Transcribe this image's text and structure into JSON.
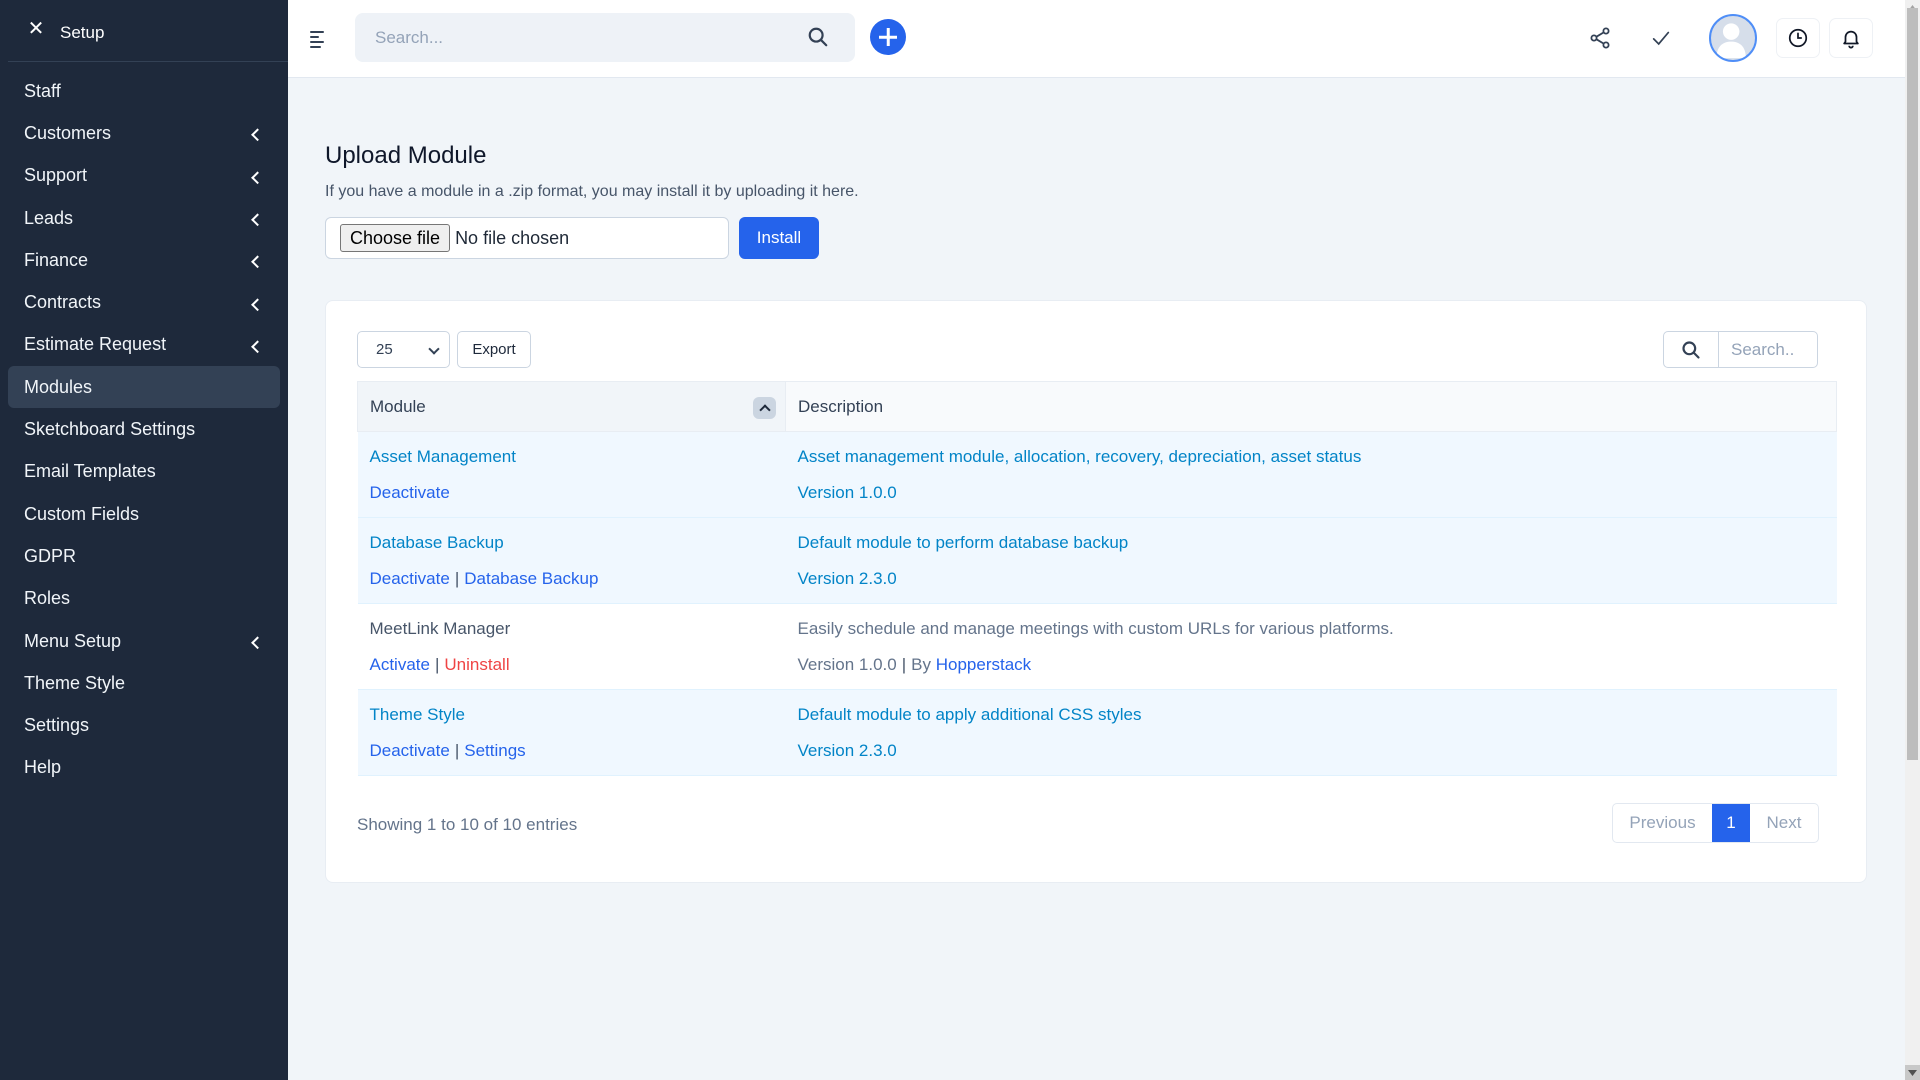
{
  "sidebar": {
    "title": "Setup",
    "close_icon": "close-icon",
    "items": [
      {
        "label": "Staff",
        "has_children": false,
        "active": false
      },
      {
        "label": "Customers",
        "has_children": true,
        "active": false
      },
      {
        "label": "Support",
        "has_children": true,
        "active": false
      },
      {
        "label": "Leads",
        "has_children": true,
        "active": false
      },
      {
        "label": "Finance",
        "has_children": true,
        "active": false
      },
      {
        "label": "Contracts",
        "has_children": true,
        "active": false
      },
      {
        "label": "Estimate Request",
        "has_children": true,
        "active": false
      },
      {
        "label": "Modules",
        "has_children": false,
        "active": true
      },
      {
        "label": "Sketchboard Settings",
        "has_children": false,
        "active": false
      },
      {
        "label": "Email Templates",
        "has_children": false,
        "active": false
      },
      {
        "label": "Custom Fields",
        "has_children": false,
        "active": false
      },
      {
        "label": "GDPR",
        "has_children": false,
        "active": false
      },
      {
        "label": "Roles",
        "has_children": false,
        "active": false
      },
      {
        "label": "Menu Setup",
        "has_children": true,
        "active": false
      },
      {
        "label": "Theme Style",
        "has_children": false,
        "active": false
      },
      {
        "label": "Settings",
        "has_children": false,
        "active": false
      },
      {
        "label": "Help",
        "has_children": false,
        "active": false
      }
    ]
  },
  "topbar": {
    "search_placeholder": "Search...",
    "icons": [
      "menu-icon",
      "search-icon",
      "plus-icon",
      "share-icon",
      "check-icon",
      "avatar",
      "clock-icon",
      "bell-icon"
    ]
  },
  "upload": {
    "title": "Upload Module",
    "subtitle": "If you have a module in a .zip format, you may install it by uploading it here.",
    "choose_file_label": "Choose file",
    "file_status": "No file chosen",
    "install_label": "Install"
  },
  "table_controls": {
    "page_length": "25",
    "export_label": "Export",
    "search_placeholder": "Search.."
  },
  "table": {
    "columns": [
      "Module",
      "Description"
    ],
    "rows": [
      {
        "name": "Asset Management",
        "active": true,
        "actions": [
          {
            "label": "Deactivate",
            "type": "link"
          }
        ],
        "description": "Asset management module, allocation, recovery, depreciation, asset status",
        "version": "Version 1.0.0",
        "author": null
      },
      {
        "name": "Database Backup",
        "active": true,
        "actions": [
          {
            "label": "Deactivate",
            "type": "link"
          },
          {
            "label": "Database Backup",
            "type": "link"
          }
        ],
        "description": "Default module to perform database backup",
        "version": "Version 2.3.0",
        "author": null
      },
      {
        "name": "MeetLink Manager",
        "active": false,
        "actions": [
          {
            "label": "Activate",
            "type": "link"
          },
          {
            "label": "Uninstall",
            "type": "danger"
          }
        ],
        "description": "Easily schedule and manage meetings with custom URLs for various platforms.",
        "version": "Version 1.0.0",
        "author_prefix": "By",
        "author": "Hopperstack"
      },
      {
        "name": "Theme Style",
        "active": true,
        "actions": [
          {
            "label": "Deactivate",
            "type": "link"
          },
          {
            "label": "Settings",
            "type": "link"
          }
        ],
        "description": "Default module to apply additional CSS styles",
        "version": "Version 2.3.0",
        "author": null
      }
    ]
  },
  "footer": {
    "showing": "Showing 1 to 10 of 10 entries",
    "pagination": {
      "previous": "Previous",
      "current": "1",
      "next": "Next"
    }
  },
  "colors": {
    "sidebar_bg": "#1e293b",
    "primary": "#2563eb",
    "module_link": "#0284c7",
    "danger": "#ef4444",
    "page_bg": "#f1f5f9"
  }
}
